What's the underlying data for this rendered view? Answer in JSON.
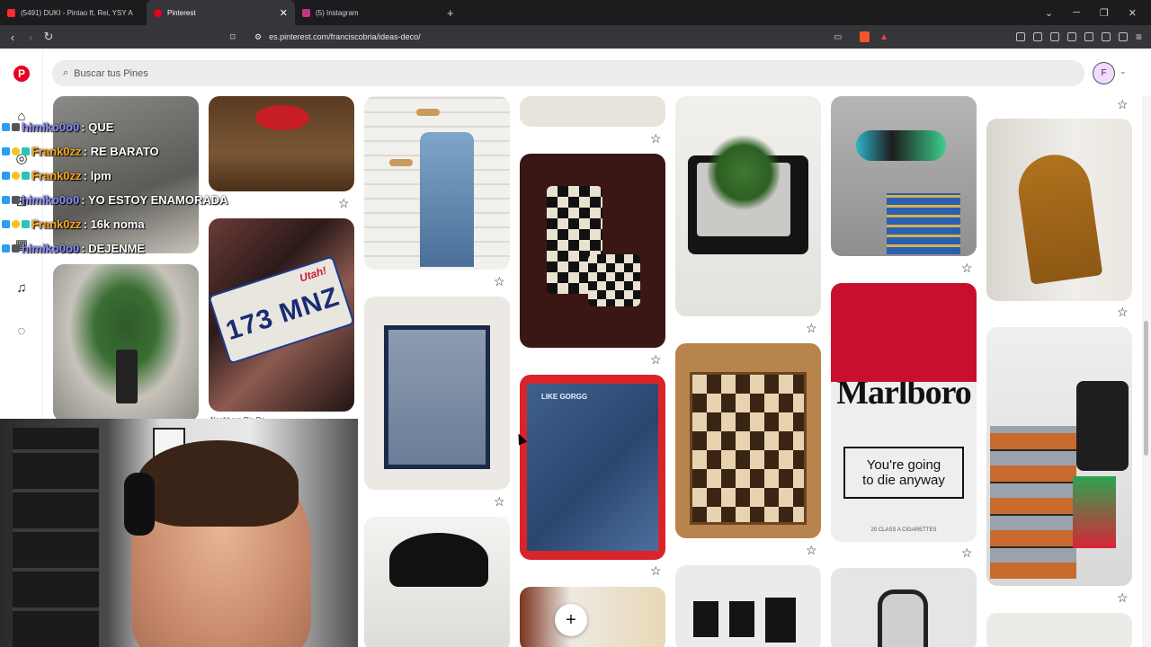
{
  "browser": {
    "tabs": [
      {
        "label": "(5491) DUKI - Pintao ft. Rei, YSY A",
        "fav_color": "#ff2a2a"
      },
      {
        "label": "Pinterest",
        "fav_color": "#e60023"
      },
      {
        "label": "(5) Instagram",
        "fav_color": "#c13584"
      }
    ],
    "new_tab": "+",
    "url": "es.pinterest.com/franciscobria/ideas-deco/"
  },
  "pinterest": {
    "search_placeholder": "Buscar tus Pines",
    "avatar_letter": "F",
    "brand_color": "#e60023",
    "license_plate_text": "173 MNZ",
    "license_plate_state": "Utah!",
    "pin_caption_partial": "Nashboro Pin Po",
    "jeans_brand_text": "LIKE GORGG",
    "marlboro": {
      "brand": "Marlboro",
      "warning_line1": "You're going",
      "warning_line2": "to die anyway",
      "footer": "20 CLASS A CIGARETTES"
    },
    "create_label": "+"
  },
  "chat": [
    {
      "user": "himiko0o0",
      "msg": ": QUE",
      "color": "#8a8cff"
    },
    {
      "user": "Frank0zz",
      "msg": ": RE BARATO",
      "color": "#f6a623"
    },
    {
      "user": "Frank0zz",
      "msg": ": lpm",
      "color": "#f6a623"
    },
    {
      "user": "himiko0o0",
      "msg": ": YO ESTOY ENAMORADA",
      "color": "#8a8cff"
    },
    {
      "user": "Frank0zz",
      "msg": ": 16k noma",
      "color": "#f6a623"
    },
    {
      "user": "himiko0o0",
      "msg": ": DEJENME",
      "color": "#8a8cff"
    }
  ]
}
